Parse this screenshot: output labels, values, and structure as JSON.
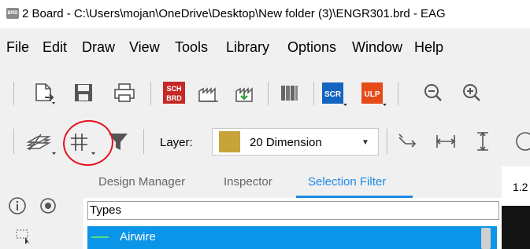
{
  "window": {
    "title": "2 Board - C:\\Users\\mojan\\OneDrive\\Desktop\\New folder (3)\\ENGR301.brd - EAG",
    "app_icon_text": "BRD"
  },
  "menu": [
    "File",
    "Edit",
    "Draw",
    "View",
    "Tools",
    "Library",
    "Options",
    "Window",
    "Help"
  ],
  "toolbar1": {
    "sch_brd_label": [
      "SCH",
      "BRD"
    ],
    "scr_label": "SCR",
    "ulp_label": "ULP"
  },
  "toolbar2": {
    "layer_label": "Layer:",
    "layer_value": "20 Dimension",
    "layer_color": "#c6a43a"
  },
  "tabs": [
    {
      "label": "Design Manager",
      "active": false
    },
    {
      "label": "Inspector",
      "active": false
    },
    {
      "label": "Selection Filter",
      "active": true
    }
  ],
  "panel": {
    "types_header": "Types",
    "selected_item": "Airwire"
  },
  "right_panel": {
    "coordinate_text": "1.2"
  },
  "colors": {
    "accent": "#1e88e5",
    "selection": "#0b95e8",
    "annotation": "#e3141e"
  }
}
